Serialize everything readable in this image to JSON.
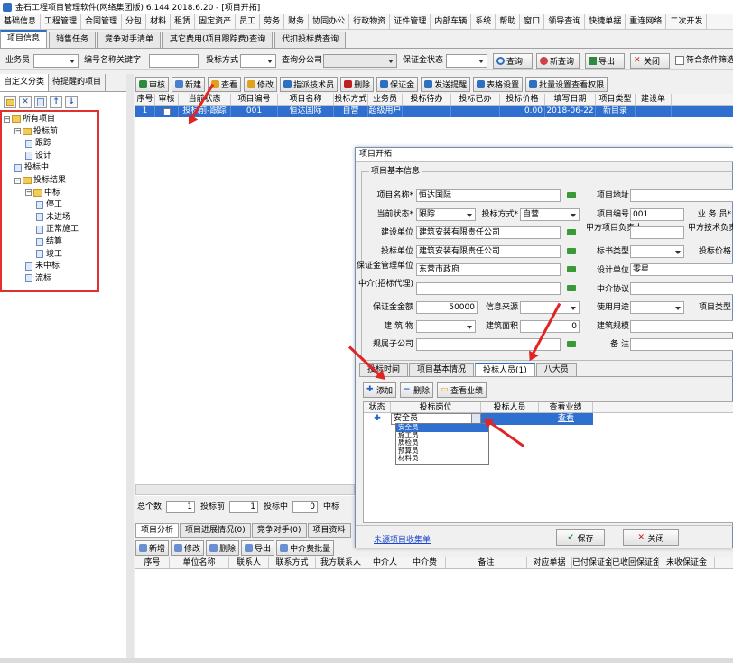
{
  "window": {
    "title": "金石工程项目管理软件(网络集团版) 6.144  2018.6.20 - [项目开拓]"
  },
  "menu": [
    "基础信息",
    "工程管理",
    "合同管理",
    "分包",
    "材料",
    "租赁",
    "固定资产",
    "员工",
    "劳务",
    "财务",
    "协同办公",
    "行政物资",
    "证件管理",
    "内部车辆",
    "系统",
    "帮助",
    "窗口",
    "领导查询",
    "快捷单据",
    "重连网络",
    "二次开发"
  ],
  "tabs": [
    "项目信息",
    "销售任务",
    "竞争对手清单",
    "其它费用(项目跟踪费)查询",
    "代扣投标费查询"
  ],
  "filter": {
    "salesman_label": "业务员",
    "name_label": "编号名称关键字",
    "bid_method_label": "投标方式",
    "branch_label": "查询分公司",
    "deposit_status_label": "保证金状态",
    "query_btn": "查询",
    "requery_btn": "新查询",
    "export_btn": "导出",
    "close_btn": "关闭",
    "match_label": "符合条件筛选"
  },
  "left": {
    "tabs": [
      "自定义分类",
      "待提醒的项目"
    ],
    "tree": [
      {
        "label": "所有项目",
        "level": 0,
        "type": "folder"
      },
      {
        "label": "投标前",
        "level": 1,
        "type": "folder"
      },
      {
        "label": "跟踪",
        "level": 2,
        "type": "doc"
      },
      {
        "label": "设计",
        "level": 2,
        "type": "doc"
      },
      {
        "label": "投标中",
        "level": 1,
        "type": "doc"
      },
      {
        "label": "投标结果",
        "level": 1,
        "type": "folder"
      },
      {
        "label": "中标",
        "level": 2,
        "type": "folder"
      },
      {
        "label": "停工",
        "level": 3,
        "type": "doc"
      },
      {
        "label": "未进场",
        "level": 3,
        "type": "doc"
      },
      {
        "label": "正常施工",
        "level": 3,
        "type": "doc"
      },
      {
        "label": "结算",
        "level": 3,
        "type": "doc"
      },
      {
        "label": "竣工",
        "level": 3,
        "type": "doc"
      },
      {
        "label": "未中标",
        "level": 2,
        "type": "doc"
      },
      {
        "label": "流标",
        "level": 2,
        "type": "doc"
      }
    ]
  },
  "main_toolbar": [
    "审核",
    "新建",
    "查看",
    "修改",
    "指派技术员",
    "删除",
    "保证金",
    "发送提醒",
    "表格设置",
    "批量设置查看权限"
  ],
  "grid": {
    "headers": [
      "序号",
      "审核",
      "当前状态",
      "项目编号",
      "项目名称",
      "投标方式",
      "业务员",
      "投标待办",
      "投标已办",
      "投标价格",
      "填写日期",
      "项目类型",
      "建设单"
    ],
    "row": [
      "1",
      "",
      "投标前-跟踪",
      "001",
      "恒达国际",
      "自营",
      "超级用户",
      "",
      "",
      "0.00",
      "2018-06-22",
      "新目录",
      ""
    ]
  },
  "summary": {
    "total_label": "总个数",
    "total": "1",
    "before_label": "投标前",
    "before": "1",
    "during_label": "投标中",
    "during": "0",
    "win_label": "中标"
  },
  "bottom": {
    "tabs": [
      "项目分析",
      "项目进展情况(0)",
      "竞争对手(0)",
      "项目资料"
    ],
    "toolbar": [
      "新增",
      "修改",
      "删除",
      "导出",
      "中介费批量"
    ],
    "headers": [
      "序号",
      "单位名称",
      "联系人",
      "联系方式",
      "我方联系人",
      "中介人",
      "中介费",
      "备注",
      "对应单据",
      "已付保证金",
      "已收回保证金",
      "未收保证金"
    ]
  },
  "dialog": {
    "title": "项目开拓",
    "group": "项目基本信息",
    "fields": {
      "name_label": "项目名称*",
      "name": "恒达国际",
      "address_label": "项目地址",
      "status_label": "当前状态*",
      "status": "跟踪",
      "bid_method_label": "投标方式*",
      "bid_method": "自营",
      "code_label": "项目编号",
      "code": "001",
      "salesman_label": "业 务 员*",
      "builder_label": "建设单位",
      "builder": "建筑安装有限责任公司",
      "leader_label": "甲方项目负责人",
      "tech_leader_label": "甲方技术负责人",
      "bid_unit_label": "投标单位",
      "bid_unit": "建筑安装有限责任公司",
      "book_type_label": "标书类型",
      "bid_price_label": "投标价格",
      "deposit_mgr_label": "保证金管理单位",
      "deposit_mgr": "东营市政府",
      "design_label": "设计单位",
      "design": "零星",
      "agent_label": "中介(招标代理)",
      "agent_agreement_label": "中介协议",
      "deposit_amt_label": "保证金金额",
      "deposit_amt": "50000",
      "source_label": "信息来源",
      "usage_label": "使用用途",
      "type_label": "项目类型",
      "building_label": "建 筑 物",
      "area_label": "建筑面积",
      "area": "0",
      "scale_label": "建筑规模",
      "sub_label": "规属子公司",
      "note_label": "备 注"
    },
    "tabs": [
      "投标时间",
      "项目基本情况",
      "投标人员(1)",
      "八大员"
    ],
    "toolbar": [
      "添加",
      "删除",
      "查看业绩"
    ],
    "grid_headers": [
      "状态",
      "投标岗位",
      "投标人员",
      "查看业绩"
    ],
    "row": {
      "post": "安全员",
      "view": "查看"
    },
    "dropdown": [
      "安全员",
      "施工员",
      "质检员",
      "预算员",
      "材料员"
    ],
    "footer": {
      "link": "未源项目收集单",
      "save": "保存",
      "close": "关闭"
    }
  }
}
